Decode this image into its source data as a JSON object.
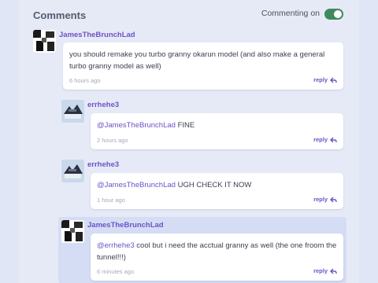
{
  "header": {
    "title": "Comments",
    "toggle_label": "Commenting on",
    "toggle_state": "on"
  },
  "reply_label": "reply",
  "comments": [
    {
      "author": "JamesTheBrunchLad",
      "text": "you should remake you turbo granny okarun model (and also make a general turbo granny model as well)",
      "mention": "",
      "time": "6 hours ago"
    },
    {
      "author": "errhehe3",
      "mention": "@JamesTheBrunchLad",
      "text": " FINE",
      "time": "2 hours ago"
    },
    {
      "author": "errhehe3",
      "mention": "@JamesTheBrunchLad",
      "text": " UGH CHECK IT NOW",
      "time": "1 hour ago"
    },
    {
      "author": "JamesTheBrunchLad",
      "mention": "@errhehe3",
      "text": " cool but i need the acctual granny as well (the one froom the tunnel!!!)",
      "time": "6 minutes ago"
    }
  ],
  "colors": {
    "accent": "#6b53c7",
    "toggle": "#3e8a5c",
    "background": "#e1e6f6"
  }
}
